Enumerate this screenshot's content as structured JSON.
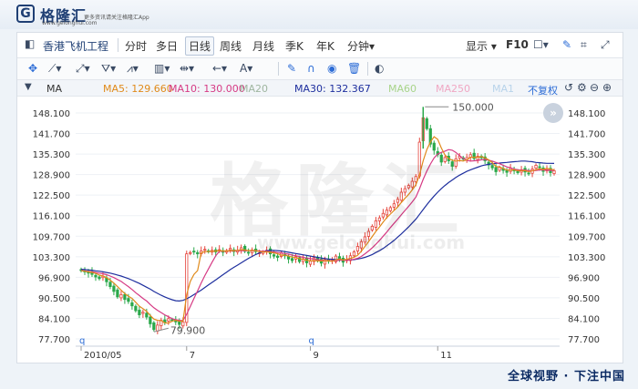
{
  "brand": {
    "name": "格隆汇",
    "sub": "www.gelonghui.com",
    "tagline": "更多资讯请关注格隆汇App",
    "watermark": "格隆汇",
    "watermark_url": "www.gelonghui.com"
  },
  "toolbar": {
    "stock_name": "香港飞机工程",
    "periods": [
      "分时",
      "多日",
      "日线",
      "周线",
      "月线",
      "季K",
      "年K",
      "分钟▾"
    ],
    "active_period": "日线",
    "display_label": "显示 ▾",
    "f10_label": "F10"
  },
  "indicators": {
    "ma_label": "MA",
    "ma5": "MA5: 129.660",
    "ma10": "MA10: 130.000",
    "ma20": "MA20",
    "ma30": "MA30: 132.367",
    "ma60": "MA60",
    "ma250": "MA250",
    "ma1": "MA1",
    "adjust": "不复权",
    "colors": {
      "ma5": "#e08a1a",
      "ma10": "#d63a84",
      "ma20": "#9fb6a0",
      "ma30": "#1e2f9e",
      "ma60": "#a8d48a",
      "ma250": "#f0a7c3",
      "ma1": "#b8d3ea"
    }
  },
  "chart_data": {
    "type": "candlestick",
    "y_ticks": [
      "148.100",
      "141.700",
      "135.300",
      "128.900",
      "122.500",
      "116.100",
      "109.700",
      "103.300",
      "96.900",
      "90.500",
      "84.100",
      "77.700"
    ],
    "ylim": [
      77.7,
      148.1
    ],
    "x_ticks": [
      "2010/05",
      "7",
      "9",
      "11"
    ],
    "annotations": [
      {
        "label": "150.000",
        "value": 150.0,
        "target": "high"
      },
      {
        "label": "79.900",
        "value": 79.9,
        "target": "low"
      }
    ],
    "close_series": [
      99,
      98.6,
      98.2,
      97.8,
      97,
      96.5,
      97.2,
      95.5,
      94,
      92.5,
      90.8,
      91.5,
      90,
      89.4,
      88,
      86.5,
      85.2,
      86,
      84.5,
      82.4,
      80.6,
      82,
      83.5,
      82.8,
      84,
      83.6,
      83,
      82.2,
      83,
      104.2,
      104.6,
      104.9,
      104.2,
      105.1,
      105.6,
      104.9,
      105.3,
      104.8,
      105.5,
      104.7,
      105.2,
      105.9,
      104.9,
      105.3,
      106.1,
      105,
      104.6,
      105.4,
      104.9,
      104.5,
      104.8,
      105.3,
      104.2,
      103.5,
      103.1,
      104.4,
      103.6,
      102.6,
      102.1,
      103.3,
      101.8,
      102.6,
      101.4,
      102,
      103,
      102.1,
      101.3,
      102.5,
      101.9,
      102.2,
      103.5,
      102.7,
      101.6,
      102.4,
      103.6,
      104.8,
      106.5,
      108,
      109.5,
      111.2,
      112.8,
      114.5,
      115.4,
      116.8,
      117.8,
      118.6,
      119.8,
      121.2,
      123.4,
      124.5,
      125.5,
      126.8,
      128.3,
      139,
      146.6,
      143.2,
      138.4,
      136.5,
      135.1,
      132.8,
      134.2,
      133.2,
      131.5,
      133.8,
      134.6,
      133.7,
      134.2,
      135.1,
      133.9,
      134.6,
      134.1,
      133.2,
      131.9,
      131,
      129.8,
      131.1,
      130.2,
      129.6,
      130.8,
      130.2,
      129.5,
      130.4,
      129.7,
      129.3,
      130.6,
      131.8,
      131.1,
      129.9,
      130.4,
      129.5,
      130.1
    ],
    "ma5_series": [
      99,
      98.8,
      98.6,
      98.4,
      98.1,
      97.6,
      97.3,
      96.8,
      96.0,
      95.1,
      94.0,
      92.9,
      91.8,
      91.0,
      90.3,
      89.1,
      87.9,
      87.1,
      86.3,
      85.0,
      83.9,
      83.5,
      83.4,
      82.7,
      82.6,
      83.2,
      83.5,
      83.2,
      83.3,
      91.5,
      95.6,
      97.8,
      99.0,
      104.5,
      104.9,
      104.9,
      105.0,
      105.1,
      105.2,
      105.1,
      105.1,
      105.2,
      105.2,
      105.3,
      105.5,
      105.4,
      105.2,
      105.3,
      105.2,
      104.9,
      104.8,
      104.8,
      104.7,
      104.5,
      104.2,
      103.8,
      103.8,
      103.5,
      103.2,
      103.1,
      102.7,
      102.5,
      102.2,
      102.0,
      102.1,
      102.0,
      102.0,
      102.0,
      102.0,
      101.9,
      102.3,
      102.6,
      102.3,
      102.5,
      102.8,
      103.1,
      103.8,
      105.0,
      106.5,
      108.0,
      109.6,
      111.2,
      112.6,
      114.1,
      115.5,
      116.6,
      117.7,
      118.8,
      120.2,
      121.5,
      122.7,
      124.1,
      125.7,
      128.8,
      133.2,
      136.7,
      139.1,
      140.7,
      139.9,
      137.2,
      135.0,
      133.9,
      133.4,
      133.1,
      133.3,
      133.1,
      133.5,
      134.3,
      134.3,
      134.3,
      134.5,
      134.1,
      133.5,
      132.6,
      131.4,
      131.3,
      130.8,
      130.3,
      130.3,
      130.4,
      130.1,
      130.1,
      130.1,
      129.8,
      130.1,
      130.4,
      130.7,
      130.5,
      130.8,
      130.6,
      130.3
    ],
    "ma10_series": [
      99,
      98.9,
      98.7,
      98.6,
      98.4,
      98.2,
      98.0,
      97.7,
      97.3,
      96.8,
      96.2,
      95.6,
      94.8,
      94.0,
      93.1,
      92.1,
      91.2,
      90.3,
      89.5,
      88.4,
      87.4,
      86.6,
      85.9,
      85.2,
      84.6,
      84.0,
      83.7,
      83.5,
      83.4,
      85.4,
      87.8,
      90.3,
      92.7,
      95.1,
      97.4,
      99.5,
      101.6,
      103.6,
      105.0,
      105.0,
      105.1,
      105.1,
      105.1,
      105.2,
      105.2,
      105.2,
      105.2,
      105.2,
      105.2,
      105.1,
      105.0,
      105.0,
      104.9,
      104.8,
      104.6,
      104.5,
      104.3,
      104.1,
      103.8,
      103.6,
      103.4,
      103.1,
      102.9,
      102.7,
      102.6,
      102.4,
      102.3,
      102.1,
      102.1,
      102.0,
      102.1,
      102.2,
      102.2,
      102.2,
      102.3,
      102.5,
      102.8,
      103.4,
      104.2,
      105.1,
      106.1,
      107.2,
      108.4,
      109.7,
      111.0,
      112.4,
      113.7,
      115.0,
      116.4,
      117.7,
      119.0,
      120.4,
      121.9,
      124.5,
      127.4,
      130.0,
      132.2,
      134.1,
      135.3,
      135.8,
      136.2,
      136.7,
      136.5,
      135.8,
      134.8,
      133.9,
      133.3,
      133.1,
      133.2,
      133.3,
      133.5,
      133.6,
      133.4,
      133.1,
      132.7,
      132.3,
      131.8,
      131.3,
      131.0,
      130.6,
      130.4,
      130.3,
      130.3,
      130.1,
      130.1,
      130.2,
      130.3,
      130.3,
      130.4,
      130.2,
      130.2
    ],
    "ma30_series": [
      99.4,
      99.3,
      99.2,
      99.1,
      98.9,
      98.8,
      98.6,
      98.4,
      98.2,
      97.9,
      97.6,
      97.3,
      96.9,
      96.5,
      96.0,
      95.5,
      95.0,
      94.4,
      93.8,
      93.2,
      92.5,
      91.9,
      91.3,
      90.8,
      90.3,
      89.9,
      89.6,
      89.5,
      89.7,
      90.2,
      90.8,
      91.5,
      92.2,
      92.9,
      93.7,
      94.5,
      95.3,
      96.1,
      96.9,
      97.7,
      98.5,
      99.3,
      100.0,
      100.7,
      101.4,
      102.1,
      102.8,
      103.4,
      104.0,
      104.5,
      104.9,
      105.2,
      105.3,
      105.3,
      105.2,
      105.1,
      104.9,
      104.7,
      104.5,
      104.3,
      104.1,
      103.9,
      103.7,
      103.5,
      103.3,
      103.1,
      102.9,
      102.7,
      102.6,
      102.5,
      102.4,
      102.4,
      102.3,
      102.3,
      102.3,
      102.4,
      102.6,
      102.8,
      103.1,
      103.5,
      104.0,
      104.6,
      105.2,
      105.9,
      106.7,
      107.5,
      108.4,
      109.4,
      110.4,
      111.5,
      112.6,
      113.8,
      115.0,
      116.5,
      118.0,
      119.5,
      120.9,
      122.2,
      123.4,
      124.5,
      125.5,
      126.4,
      127.2,
      128.0,
      128.7,
      129.3,
      129.9,
      130.4,
      130.8,
      131.2,
      131.6,
      131.9,
      132.1,
      132.3,
      132.4,
      132.5,
      132.6,
      132.7,
      132.8,
      132.9,
      133.0,
      133.1,
      133.1,
      133.0,
      132.9,
      132.7,
      132.6,
      132.5,
      132.4,
      132.4,
      132.37
    ]
  },
  "footer": "全球视野 · 下注中国"
}
